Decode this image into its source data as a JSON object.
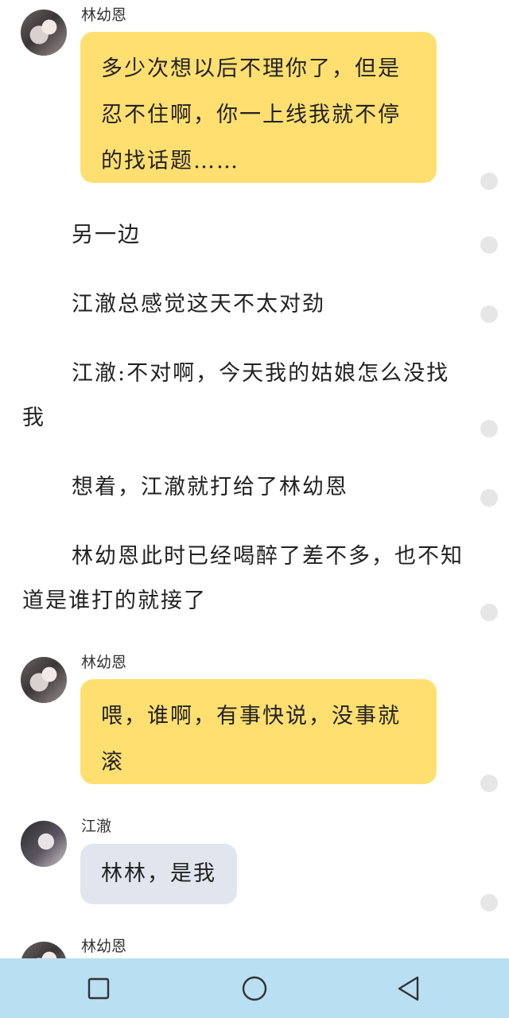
{
  "messages": [
    {
      "sender": "林幼恩",
      "text": "多少次想以后不理你了，但是忍不住啊，你一上线我就不停的找话题……"
    },
    {
      "sender": "林幼恩",
      "text": "喂，谁啊，有事快说，没事就滚"
    },
    {
      "sender": "江澈",
      "text": "林林，是我"
    },
    {
      "sender": "林幼恩"
    }
  ],
  "narration": [
    "另一边",
    "江澈总感觉这天不太对劲",
    "江澈:不对啊，今天我的姑娘怎么没找我",
    "想着，江澈就打给了林幼恩",
    "林幼恩此时已经喝醉了差不多，也不知道是谁打的就接了"
  ],
  "navbar": {
    "icons": [
      "square-icon",
      "circle-icon",
      "triangle-back-icon"
    ]
  },
  "colors": {
    "bubble_yellow": "#ffdf70",
    "bubble_gray": "#e1e6ee",
    "navbar": "#b9dff2"
  }
}
